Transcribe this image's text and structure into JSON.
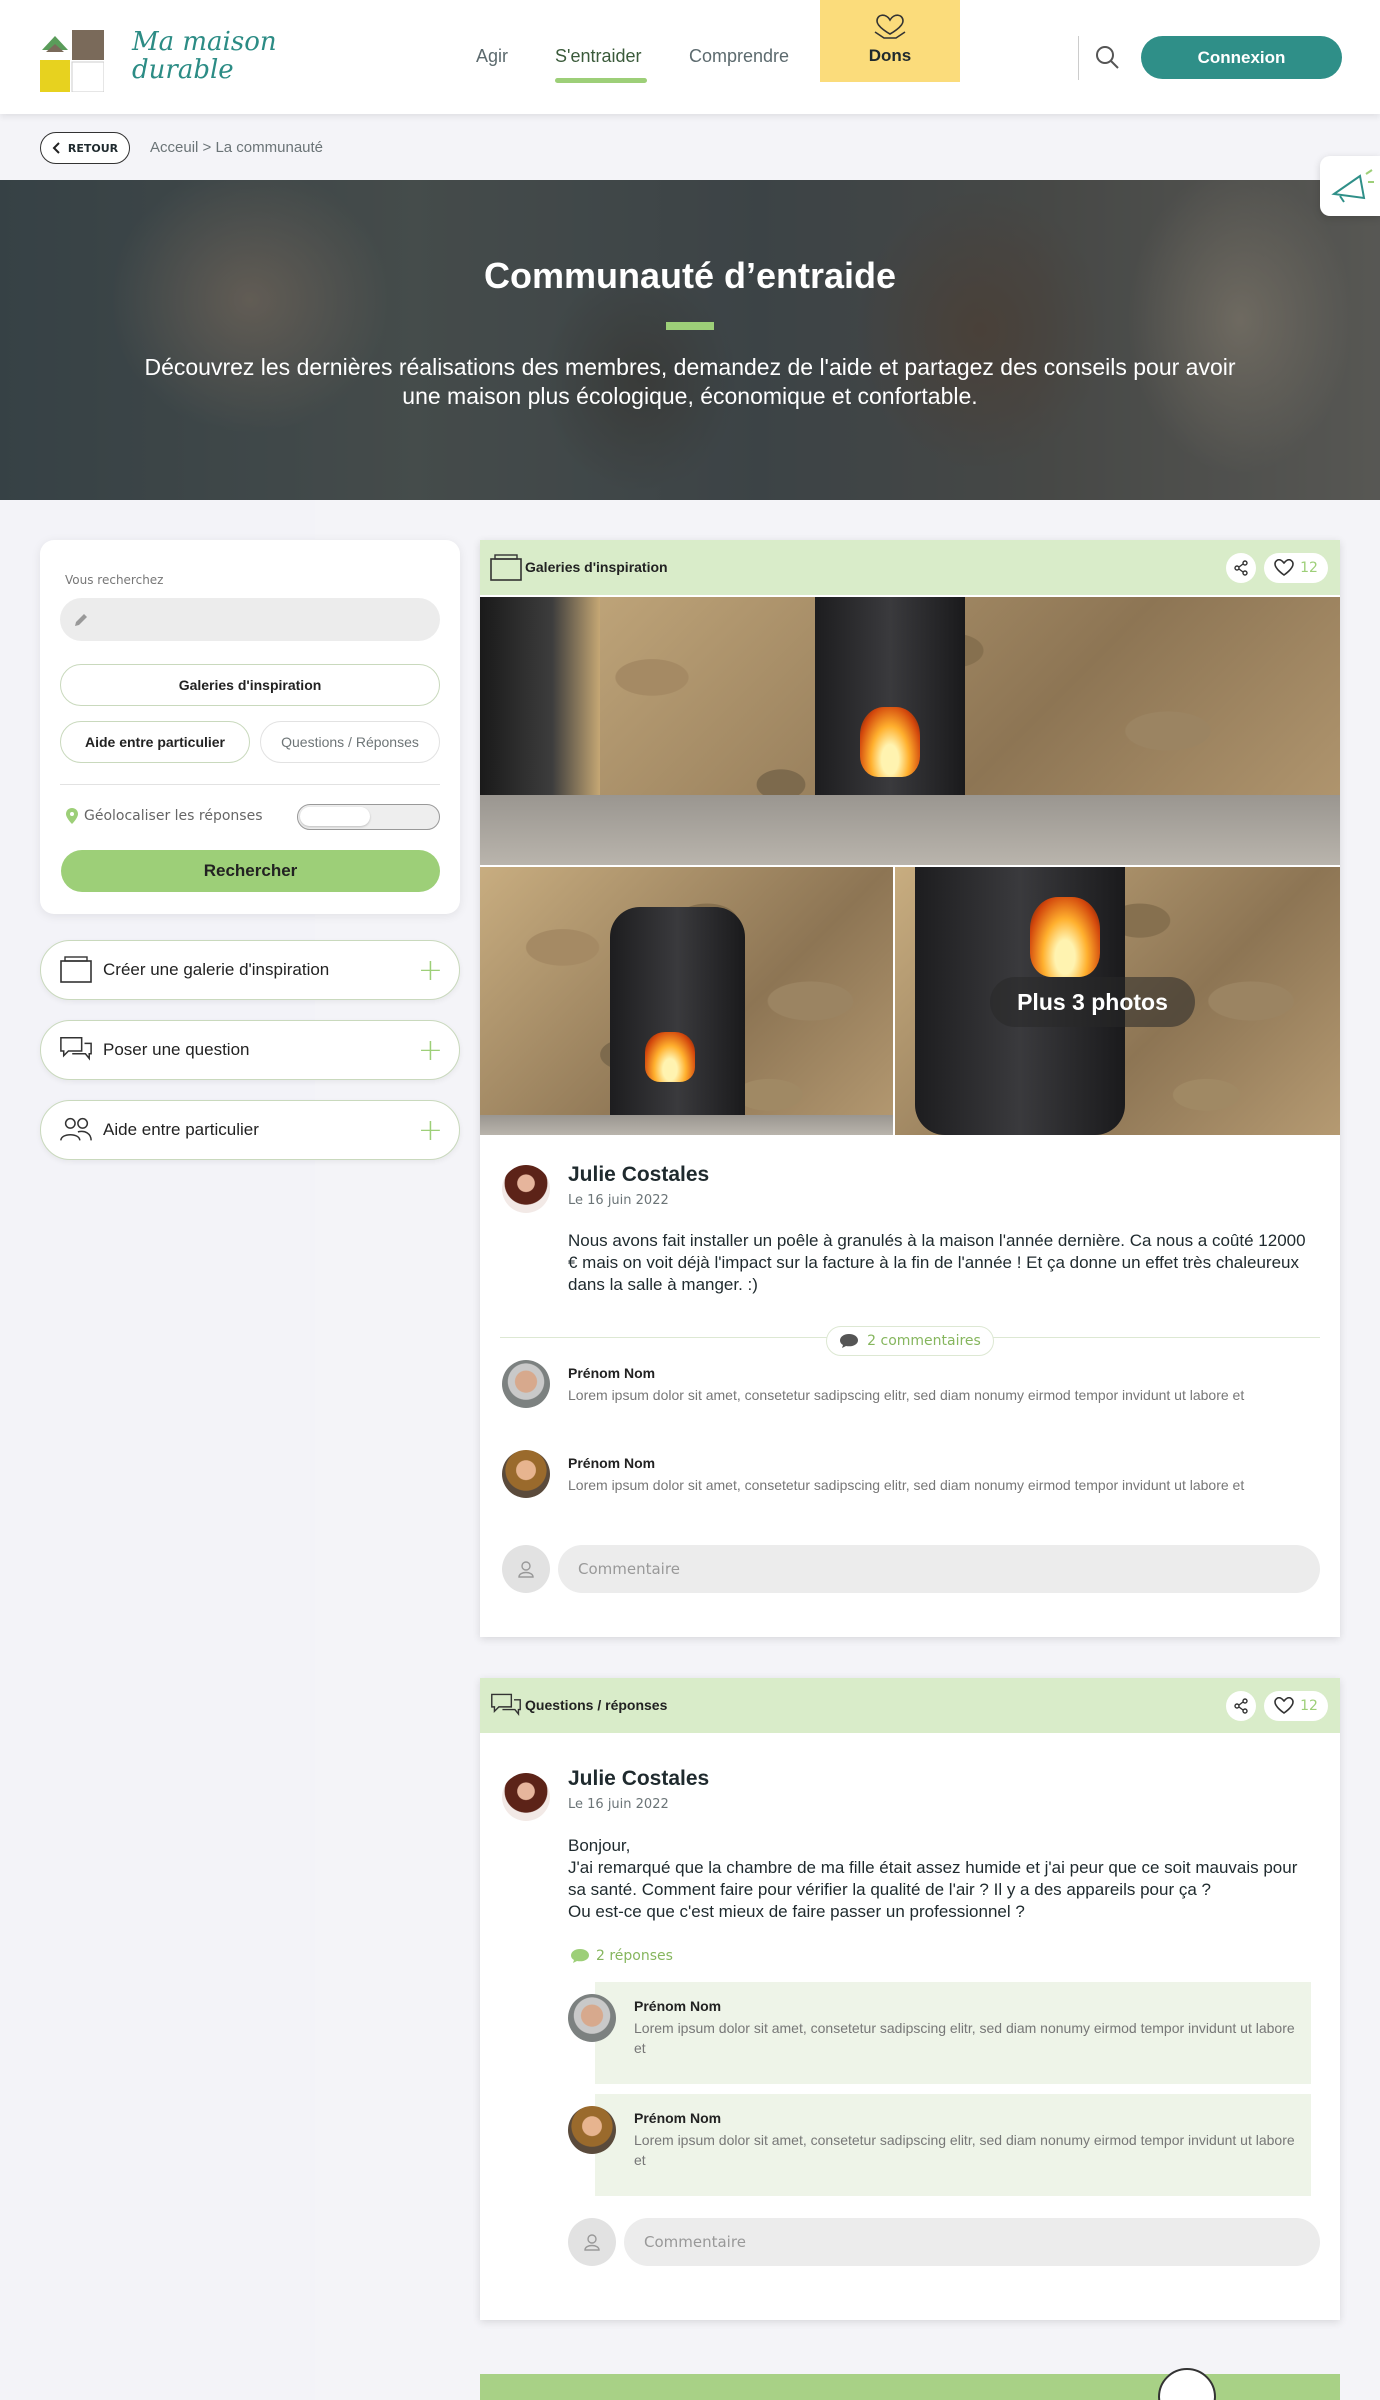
{
  "header": {
    "logo_text_line1": "Ma maison",
    "logo_text_line2": "durable",
    "nav": [
      "Agir",
      "S'entraider",
      "Comprendre"
    ],
    "dons": "Dons",
    "connexion": "Connexion"
  },
  "breadcrumb": {
    "back": "RETOUR",
    "path": "Acceuil  >  La communauté"
  },
  "hero": {
    "title": "Communauté d’entraide",
    "subtitle": "Découvrez les dernières réalisations des membres, demandez de l'aide et partagez des conseils pour avoir une maison plus écologique, économique et confortable."
  },
  "search": {
    "label": "Vous recherchez",
    "filters": [
      "Galeries d'inspiration",
      "Aide entre particulier",
      "Questions / Réponses"
    ],
    "geoloc": "Géolocaliser les réponses",
    "button": "Rechercher"
  },
  "actions": [
    "Créer une galerie d'inspiration",
    "Poser une question",
    "Aide entre particulier"
  ],
  "post1": {
    "category": "Galeries d'inspiration",
    "likes": "12",
    "more_photos": "Plus 3 photos",
    "author": "Julie Costales",
    "date": "Le 16 juin 2022",
    "text": "Nous avons fait installer un poêle à granulés à la maison l'année dernière. Ca nous a coûté 12000 € mais on voit déjà l'impact sur la facture à la fin de l'année ! Et ça donne un effet très chaleureux dans la salle à manger. :)",
    "comments_count": "2 commentaires",
    "comments": [
      {
        "name": "Prénom Nom",
        "text": "Lorem ipsum dolor sit amet, consetetur sadipscing elitr, sed diam nonumy eirmod tempor invidunt ut labore et"
      },
      {
        "name": "Prénom Nom",
        "text": "Lorem ipsum dolor sit amet, consetetur sadipscing elitr, sed diam nonumy eirmod tempor invidunt ut labore et"
      }
    ],
    "comment_placeholder": "Commentaire"
  },
  "post2": {
    "category": "Questions / réponses",
    "likes": "12",
    "author": "Julie Costales",
    "date": "Le 16 juin 2022",
    "text_lines": [
      "Bonjour,",
      "J'ai remarqué que la chambre de ma fille était assez humide et j'ai peur que ce soit mauvais pour sa santé. Comment faire pour vérifier la qualité de l'air ? Il y a des appareils pour ça ?",
      "Ou est-ce que c'est mieux de faire passer un professionnel ?"
    ],
    "replies_count": "2 réponses",
    "replies": [
      {
        "name": "Prénom Nom",
        "text": "Lorem ipsum dolor sit amet, consetetur sadipscing elitr, sed diam nonumy eirmod tempor invidunt ut labore et"
      },
      {
        "name": "Prénom Nom",
        "text": "Lorem ipsum dolor sit amet, consetetur sadipscing elitr, sed diam nonumy eirmod tempor invidunt ut labore et"
      }
    ],
    "comment_placeholder": "Commentaire"
  },
  "colors": {
    "accent_green": "#9dcf78",
    "brand_teal": "#2f8f88",
    "dons_yellow": "#fbdc7b"
  }
}
